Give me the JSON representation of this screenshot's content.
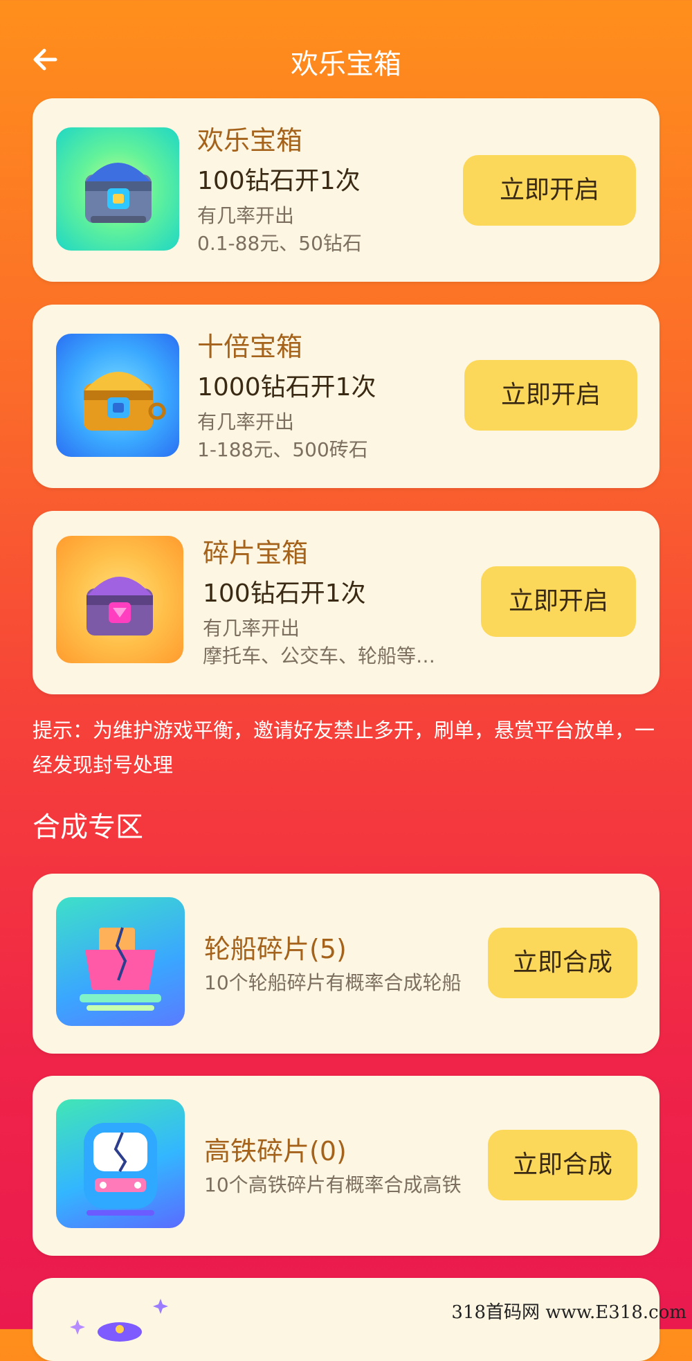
{
  "header": {
    "title": "欢乐宝箱",
    "back_icon": "arrow-left-icon"
  },
  "boxes": [
    {
      "name": "欢乐宝箱",
      "price": "100钻石开1次",
      "desc1": "有几率开出",
      "desc2": "0.1-88元、50钻石",
      "button": "立即开启",
      "icon": "chest-blue-icon"
    },
    {
      "name": "十倍宝箱",
      "price": "1000钻石开1次",
      "desc1": "有几率开出",
      "desc2": "1-188元、500砖石",
      "button": "立即开启",
      "icon": "chest-gold-icon"
    },
    {
      "name": "碎片宝箱",
      "price": "100钻石开1次",
      "desc1": "有几率开出",
      "desc2": "摩托车、公交车、轮船等…",
      "button": "立即开启",
      "icon": "chest-purple-icon"
    }
  ],
  "notice": "提示：为维护游戏平衡，邀请好友禁止多开，刷单，悬赏平台放单，一经发现封号处理",
  "section_title": "合成专区",
  "synth": [
    {
      "name": "轮船碎片(5)",
      "desc": "10个轮船碎片有概率合成轮船",
      "button": "立即合成",
      "icon": "ship-fragment-icon"
    },
    {
      "name": "高铁碎片(0)",
      "desc": "10个高铁碎片有概率合成高铁",
      "button": "立即合成",
      "icon": "train-fragment-icon"
    }
  ],
  "watermark": "318首码网 www.E318.com"
}
